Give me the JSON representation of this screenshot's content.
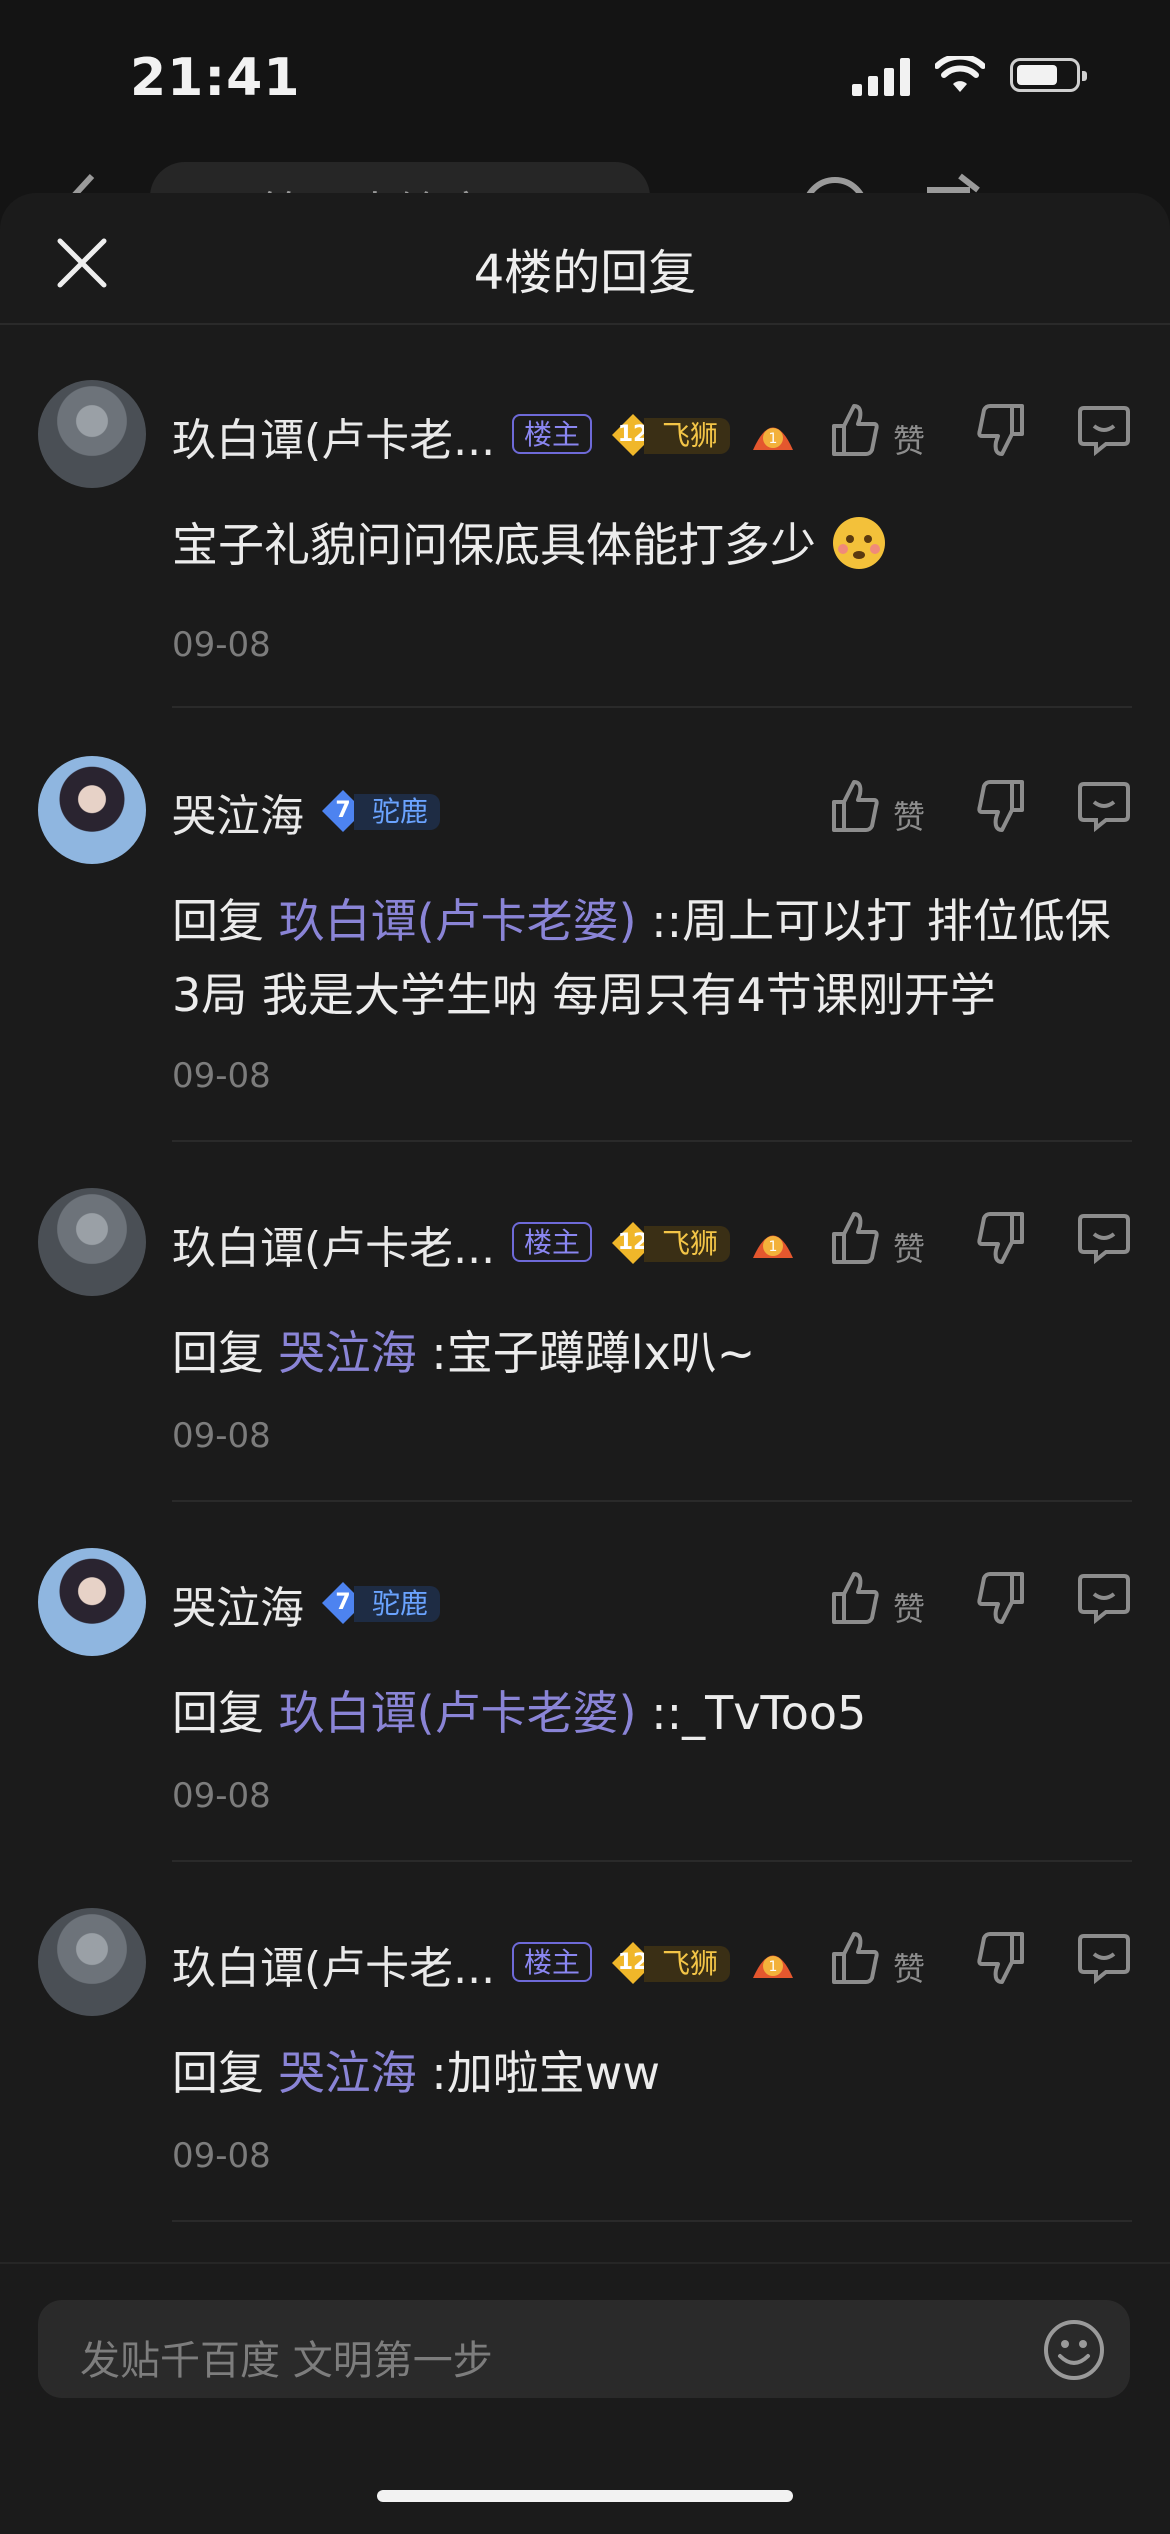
{
  "status": {
    "time": "21:41"
  },
  "background_nav": {
    "title": "篮下中锋字母哥"
  },
  "sheet": {
    "title": "4楼的回复"
  },
  "comments": [
    {
      "user": "玖白谭(卢卡老...",
      "owner_tag": "楼主",
      "level": "12",
      "rank": "飞狮",
      "medal_level": "1",
      "like_label": "赞",
      "text": "宝子礼貌问问保底具体能打多少",
      "text_emoji": "flushed-face-icon",
      "date": "09-08"
    },
    {
      "user": "哭泣海",
      "level": "7",
      "rank": "驼鹿",
      "like_label": "赞",
      "reply_prefix": "回复 ",
      "mention": "玖白谭(卢卡老婆)",
      "text": " ::周上可以打 排位低保3局 我是大学生呐 每周只有4节课刚开学",
      "date": "09-08"
    },
    {
      "user": "玖白谭(卢卡老...",
      "owner_tag": "楼主",
      "level": "12",
      "rank": "飞狮",
      "medal_level": "1",
      "like_label": "赞",
      "reply_prefix": "回复 ",
      "mention": "哭泣海",
      "text": " :宝子蹲蹲lx叭~",
      "date": "09-08"
    },
    {
      "user": "哭泣海",
      "level": "7",
      "rank": "驼鹿",
      "like_label": "赞",
      "reply_prefix": "回复 ",
      "mention": "玖白谭(卢卡老婆)",
      "text": " ::_TvToo5",
      "date": "09-08"
    },
    {
      "user": "玖白谭(卢卡老...",
      "owner_tag": "楼主",
      "level": "12",
      "rank": "飞狮",
      "medal_level": "1",
      "like_label": "赞",
      "reply_prefix": "回复 ",
      "mention": "哭泣海",
      "text": " :加啦宝ww",
      "date": "09-08"
    }
  ],
  "input": {
    "placeholder": "发贴千百度 文明第一步"
  },
  "colors": {
    "accent_mention": "#8a84d6",
    "owner_tag": "#6e6ad8",
    "gold": "#f3c547",
    "blue": "#6aa3ff"
  }
}
